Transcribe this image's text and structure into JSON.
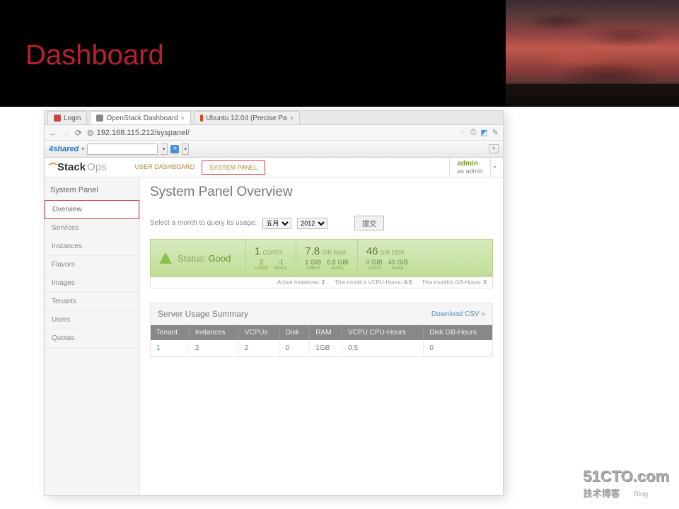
{
  "slide": {
    "title": "Dashboard"
  },
  "tabs": [
    {
      "label": "Login",
      "favicon_color": "#c64a4a"
    },
    {
      "label": "OpenStack Dashboard",
      "favicon_color": "#888"
    },
    {
      "label": "Ubuntu 12.04 (Precise Pa",
      "favicon_color": "#dd4814"
    }
  ],
  "url": "192.168.115.212/syspanel/",
  "toolbar": {
    "brand": "4shared",
    "plus": "+"
  },
  "app": {
    "brand_main": "Stack",
    "brand_sub": "Ops",
    "nav": {
      "user_dashboard": "USER DASHBOARD",
      "system_panel": "SYSTEM PANEL"
    },
    "user": {
      "name": "admin",
      "role": "as admin"
    }
  },
  "sidebar": {
    "title": "System Panel",
    "items": [
      "Overview",
      "Services",
      "Instances",
      "Flavors",
      "Images",
      "Tenants",
      "Users",
      "Quotas"
    ]
  },
  "page": {
    "title": "System Panel Overview",
    "query_label": "Select a month to query its usage:",
    "month": "五月",
    "year": "2012",
    "submit": "提交"
  },
  "status": {
    "label": "Status:",
    "value": "Good",
    "cells": [
      {
        "big": "1",
        "unit": "CORES",
        "sub": [
          {
            "v": "2",
            "l": "USED"
          },
          {
            "v": "-1",
            "l": "AVAIL"
          }
        ]
      },
      {
        "big": "7.8",
        "unit": "GIB RAM",
        "sub": [
          {
            "v": "1 GIB",
            "l": "USED"
          },
          {
            "v": "6.8 GIB",
            "l": "AVAIL"
          }
        ]
      },
      {
        "big": "46",
        "unit": "GIB DISK",
        "sub": [
          {
            "v": "0 GIB",
            "l": "USED"
          },
          {
            "v": "46 GIB",
            "l": "AVAIL"
          }
        ]
      }
    ],
    "footer": [
      {
        "label": "Active Instances:",
        "value": "2"
      },
      {
        "label": "This month's VCPU-Hours:",
        "value": "0.5"
      },
      {
        "label": "This month's GB-Hours:",
        "value": "0"
      }
    ]
  },
  "usage": {
    "title": "Server Usage Summary",
    "download": "Download CSV »",
    "headers": [
      "Tenant",
      "Instances",
      "VCPUs",
      "Disk",
      "RAM",
      "VCPU CPU-Hours",
      "Disk GB-Hours"
    ],
    "row": [
      "1",
      "2",
      "2",
      "0",
      "1GB",
      "0.5",
      "0"
    ]
  },
  "watermark": {
    "line1": "51CTO.com",
    "line2": "技术博客",
    "blog": "Blog"
  }
}
